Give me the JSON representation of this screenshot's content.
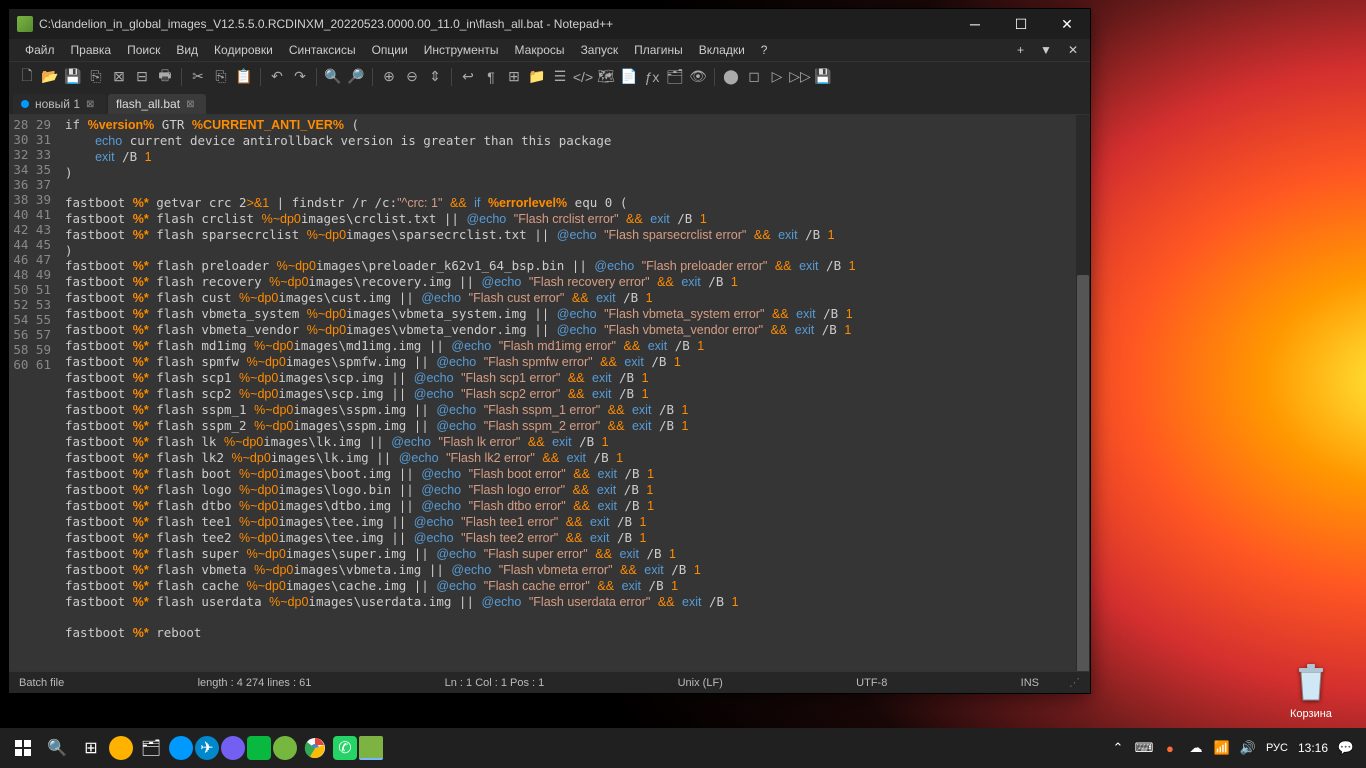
{
  "window": {
    "title": "C:\\dandelion_in_global_images_V12.5.5.0.RCDINXM_20220523.0000.00_11.0_in\\flash_all.bat - Notepad++"
  },
  "menu": {
    "items": [
      "Файл",
      "Правка",
      "Поиск",
      "Вид",
      "Кодировки",
      "Синтаксисы",
      "Опции",
      "Инструменты",
      "Макросы",
      "Запуск",
      "Плагины",
      "Вкладки",
      "?"
    ]
  },
  "tabs": [
    {
      "label": "новый 1",
      "active": false
    },
    {
      "label": "flash_all.bat",
      "active": true
    }
  ],
  "lines": {
    "start": 28,
    "end": 61
  },
  "code_lines": [
    {
      "n": 28,
      "t": "if <v>%version%</v> GTR <v>%CURRENT_ANTI_VER%</v> ("
    },
    {
      "n": 29,
      "t": "    <k>echo</k> current device antirollback version is greater than this package"
    },
    {
      "n": 30,
      "t": "    <k>exit</k> /B <o>1</o>"
    },
    {
      "n": 31,
      "t": ")"
    },
    {
      "n": 32,
      "t": ""
    },
    {
      "n": 33,
      "t": "fastboot <v>%*</v> getvar crc 2<o>>&1</o> | findstr /r /c:<s>\"^crc: 1\"</s> <o>&&</o> <k>if</k> <v>%errorlevel%</v> equ 0 ("
    },
    {
      "n": 34,
      "t": "fastboot <v>%*</v> flash crclist <p>%~dp0</p>images\\crclist.txt || <k>@echo</k> <s>\"Flash crclist error\"</s> <o>&&</o> <k>exit</k> /B <o>1</o>"
    },
    {
      "n": 35,
      "t": "fastboot <v>%*</v> flash sparsecrclist <p>%~dp0</p>images\\sparsecrclist.txt || <k>@echo</k> <s>\"Flash sparsecrclist error\"</s> <o>&&</o> <k>exit</k> /B <o>1</o>"
    },
    {
      "n": 36,
      "t": ")"
    },
    {
      "n": 37,
      "t": "fastboot <v>%*</v> flash preloader <p>%~dp0</p>images\\preloader_k62v1_64_bsp.bin || <k>@echo</k> <s>\"Flash preloader error\"</s> <o>&&</o> <k>exit</k> /B <o>1</o>"
    },
    {
      "n": 38,
      "t": "fastboot <v>%*</v> flash recovery <p>%~dp0</p>images\\recovery.img || <k>@echo</k> <s>\"Flash recovery error\"</s> <o>&&</o> <k>exit</k> /B <o>1</o>"
    },
    {
      "n": 39,
      "t": "fastboot <v>%*</v> flash cust <p>%~dp0</p>images\\cust.img || <k>@echo</k> <s>\"Flash cust error\"</s> <o>&&</o> <k>exit</k> /B <o>1</o>"
    },
    {
      "n": 40,
      "t": "fastboot <v>%*</v> flash vbmeta_system <p>%~dp0</p>images\\vbmeta_system.img || <k>@echo</k> <s>\"Flash vbmeta_system error\"</s> <o>&&</o> <k>exit</k> /B <o>1</o>"
    },
    {
      "n": 41,
      "t": "fastboot <v>%*</v> flash vbmeta_vendor <p>%~dp0</p>images\\vbmeta_vendor.img || <k>@echo</k> <s>\"Flash vbmeta_vendor error\"</s> <o>&&</o> <k>exit</k> /B <o>1</o>"
    },
    {
      "n": 42,
      "t": "fastboot <v>%*</v> flash md1img <p>%~dp0</p>images\\md1img.img || <k>@echo</k> <s>\"Flash md1img error\"</s> <o>&&</o> <k>exit</k> /B <o>1</o>"
    },
    {
      "n": 43,
      "t": "fastboot <v>%*</v> flash spmfw <p>%~dp0</p>images\\spmfw.img || <k>@echo</k> <s>\"Flash spmfw error\"</s> <o>&&</o> <k>exit</k> /B <o>1</o>"
    },
    {
      "n": 44,
      "t": "fastboot <v>%*</v> flash scp1 <p>%~dp0</p>images\\scp.img || <k>@echo</k> <s>\"Flash scp1 error\"</s> <o>&&</o> <k>exit</k> /B <o>1</o>"
    },
    {
      "n": 45,
      "t": "fastboot <v>%*</v> flash scp2 <p>%~dp0</p>images\\scp.img || <k>@echo</k> <s>\"Flash scp2 error\"</s> <o>&&</o> <k>exit</k> /B <o>1</o>"
    },
    {
      "n": 46,
      "t": "fastboot <v>%*</v> flash sspm_1 <p>%~dp0</p>images\\sspm.img || <k>@echo</k> <s>\"Flash sspm_1 error\"</s> <o>&&</o> <k>exit</k> /B <o>1</o>"
    },
    {
      "n": 47,
      "t": "fastboot <v>%*</v> flash sspm_2 <p>%~dp0</p>images\\sspm.img || <k>@echo</k> <s>\"Flash sspm_2 error\"</s> <o>&&</o> <k>exit</k> /B <o>1</o>"
    },
    {
      "n": 48,
      "t": "fastboot <v>%*</v> flash lk <p>%~dp0</p>images\\lk.img || <k>@echo</k> <s>\"Flash lk error\"</s> <o>&&</o> <k>exit</k> /B <o>1</o>"
    },
    {
      "n": 49,
      "t": "fastboot <v>%*</v> flash lk2 <p>%~dp0</p>images\\lk.img || <k>@echo</k> <s>\"Flash lk2 error\"</s> <o>&&</o> <k>exit</k> /B <o>1</o>"
    },
    {
      "n": 50,
      "t": "fastboot <v>%*</v> flash boot <p>%~dp0</p>images\\boot.img || <k>@echo</k> <s>\"Flash boot error\"</s> <o>&&</o> <k>exit</k> /B <o>1</o>"
    },
    {
      "n": 51,
      "t": "fastboot <v>%*</v> flash logo <p>%~dp0</p>images\\logo.bin || <k>@echo</k> <s>\"Flash logo error\"</s> <o>&&</o> <k>exit</k> /B <o>1</o>"
    },
    {
      "n": 52,
      "t": "fastboot <v>%*</v> flash dtbo <p>%~dp0</p>images\\dtbo.img || <k>@echo</k> <s>\"Flash dtbo error\"</s> <o>&&</o> <k>exit</k> /B <o>1</o>"
    },
    {
      "n": 53,
      "t": "fastboot <v>%*</v> flash tee1 <p>%~dp0</p>images\\tee.img || <k>@echo</k> <s>\"Flash tee1 error\"</s> <o>&&</o> <k>exit</k> /B <o>1</o>"
    },
    {
      "n": 54,
      "t": "fastboot <v>%*</v> flash tee2 <p>%~dp0</p>images\\tee.img || <k>@echo</k> <s>\"Flash tee2 error\"</s> <o>&&</o> <k>exit</k> /B <o>1</o>"
    },
    {
      "n": 55,
      "t": "fastboot <v>%*</v> flash super <p>%~dp0</p>images\\super.img || <k>@echo</k> <s>\"Flash super error\"</s> <o>&&</o> <k>exit</k> /B <o>1</o>"
    },
    {
      "n": 56,
      "t": "fastboot <v>%*</v> flash vbmeta <p>%~dp0</p>images\\vbmeta.img || <k>@echo</k> <s>\"Flash vbmeta error\"</s> <o>&&</o> <k>exit</k> /B <o>1</o>"
    },
    {
      "n": 57,
      "t": "fastboot <v>%*</v> flash cache <p>%~dp0</p>images\\cache.img || <k>@echo</k> <s>\"Flash cache error\"</s> <o>&&</o> <k>exit</k> /B <o>1</o>"
    },
    {
      "n": 58,
      "t": "fastboot <v>%*</v> flash userdata <p>%~dp0</p>images\\userdata.img || <k>@echo</k> <s>\"Flash userdata error\"</s> <o>&&</o> <k>exit</k> /B <o>1</o>"
    },
    {
      "n": 59,
      "t": ""
    },
    {
      "n": 60,
      "t": "fastboot <v>%*</v> reboot"
    },
    {
      "n": 61,
      "t": ""
    }
  ],
  "status": {
    "filetype": "Batch file",
    "length": "length : 4 274    lines : 61",
    "pos": "Ln : 1    Col : 1    Pos : 1",
    "eol": "Unix (LF)",
    "enc": "UTF-8",
    "ins": "INS"
  },
  "desktop": {
    "trash": "Корзина"
  },
  "tray": {
    "lang": "РУС",
    "clock": "13:16"
  }
}
